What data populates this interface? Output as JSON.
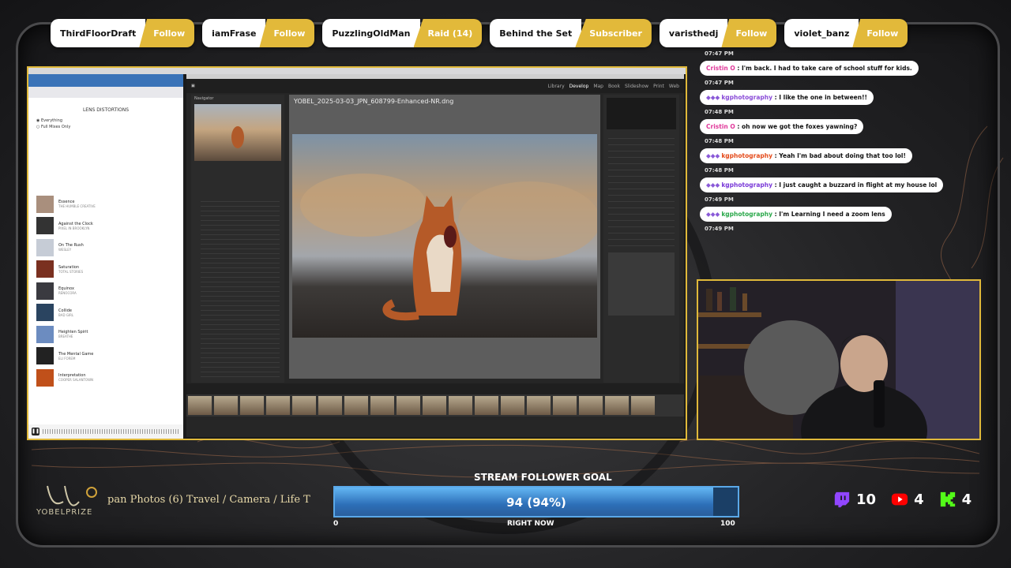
{
  "alerts": [
    {
      "name": "ThirdFloorDraft",
      "action": "Follow"
    },
    {
      "name": "iamFrase",
      "action": "Follow"
    },
    {
      "name": "PuzzlingOldMan",
      "action": "Raid (14)"
    },
    {
      "name": "Behind the Set",
      "action": "Subscriber"
    },
    {
      "name": "varisthedj",
      "action": "Follow"
    },
    {
      "name": "violet_banz",
      "action": "Follow"
    }
  ],
  "browser": {
    "lens_title": "LENS DISTORTIONS",
    "filter_everything": "Everything",
    "filter_full_mixes": "Full Mixes Only",
    "tracks": [
      {
        "title": "Essence",
        "artist": "THE HUMBLE CREATIVE"
      },
      {
        "title": "Against the Clock",
        "artist": "PIXEL IN BROOKLYN"
      },
      {
        "title": "On The Rush",
        "artist": "WESLEY"
      },
      {
        "title": "Saturation",
        "artist": "TOTAL STORIES"
      },
      {
        "title": "Equinox",
        "artist": "RENOCORA"
      },
      {
        "title": "Collide",
        "artist": "BAD GIRL"
      },
      {
        "title": "Heighten Spirit",
        "artist": "BREATHE"
      },
      {
        "title": "The Mental Game",
        "artist": "ELI FOREM"
      },
      {
        "title": "Interpretation",
        "artist": "COOPER SALANTOWN"
      }
    ]
  },
  "lightroom": {
    "modules": [
      "Library",
      "Develop",
      "Map",
      "Book",
      "Slideshow",
      "Print",
      "Web"
    ],
    "active_module": "Develop",
    "panel_navigator": "Navigator",
    "filename": "YOBEL_2025-03-03_JPN_608799-Enhanced-NR.dng"
  },
  "chat": [
    {
      "time": "07:47 PM"
    },
    {
      "time": "07:47 PM",
      "user": "Cristin O",
      "user_color": "#e0389a",
      "text": "I'm back. I had to take care of school stuff for kids.",
      "badges": ""
    },
    {
      "time": "07:48 PM",
      "user": "kgphotography",
      "user_color": "#8a4cd8",
      "text": "I like the one in between!!",
      "badges": "◆◆◆"
    },
    {
      "time": "07:48 PM",
      "user": "Cristin O",
      "user_color": "#e0389a",
      "text": "oh now we got the foxes yawning?",
      "badges": ""
    },
    {
      "time": "07:48 PM",
      "user": "kgphotography",
      "user_color": "#e44a1a",
      "text": "Yeah I'm bad about doing that too lol!",
      "badges": "◆◆◆"
    },
    {
      "time": "07:49 PM",
      "user": "kgphotography",
      "user_color": "#7a3ad8",
      "text": "I just caught a buzzard in flight at my house lol",
      "badges": "◆◆◆"
    },
    {
      "time": "07:49 PM",
      "user": "kgphotography",
      "user_color": "#2aa84a",
      "text": "I'm Learning I need a zoom lens",
      "badges": "◆◆◆"
    }
  ],
  "brand": {
    "name": "YOBELPRIZE"
  },
  "ticker": "pan Photos (6) Travel / Camera / Life T",
  "goal": {
    "title": "STREAM FOLLOWER GOAL",
    "label": "94 (94%)",
    "current": 94,
    "min_label": "0",
    "max_label": "100",
    "max": 100,
    "now_label": "RIGHT NOW"
  },
  "platforms": [
    {
      "name": "twitch-icon",
      "count": "10",
      "color": "#9146ff"
    },
    {
      "name": "youtube-icon",
      "count": "4",
      "color": "#ff0000"
    },
    {
      "name": "kick-icon",
      "count": "4",
      "color": "#53fc18"
    }
  ]
}
